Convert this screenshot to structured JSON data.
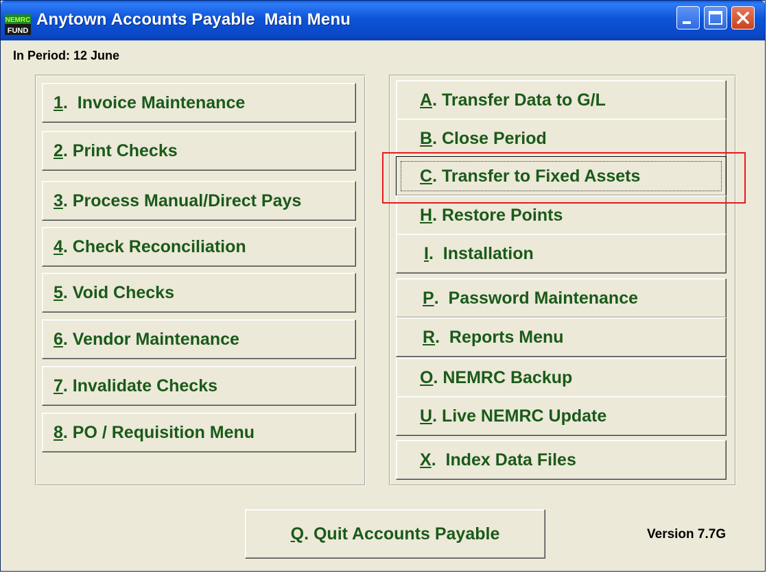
{
  "window": {
    "title": "Anytown Accounts Payable  Main Menu",
    "app_icon_top": "NEMRC",
    "app_icon_bottom": "FUND"
  },
  "period_label": "In Period: 12 June",
  "left_menu": [
    {
      "key": "1",
      "rest": ".  Invoice Maintenance"
    },
    {
      "key": "2",
      "rest": ". Print Checks"
    },
    {
      "key": "3",
      "rest": ". Process Manual/Direct Pays"
    },
    {
      "key": "4",
      "rest": ". Check Reconciliation"
    },
    {
      "key": "5",
      "rest": ". Void Checks"
    },
    {
      "key": "6",
      "rest": ". Vendor Maintenance"
    },
    {
      "key": "7",
      "rest": ". Invalidate Checks"
    },
    {
      "key": "8",
      "rest": ". PO / Requisition Menu"
    }
  ],
  "right_menu": [
    {
      "key": "A",
      "rest": ". Transfer Data to G/L"
    },
    {
      "key": "B",
      "rest": ". Close Period"
    },
    {
      "key": "C",
      "rest": ". Transfer to Fixed Assets"
    },
    {
      "key": "H",
      "rest": ". Restore Points"
    },
    {
      "key": "I",
      "rest": ".  Installation"
    },
    {
      "key": "P",
      "rest": ".  Password Maintenance"
    },
    {
      "key": "R",
      "rest": ".  Reports Menu"
    },
    {
      "key": "O",
      "rest": ". NEMRC Backup"
    },
    {
      "key": "U",
      "rest": ". Live NEMRC Update"
    },
    {
      "key": "X",
      "rest": ".  Index Data Files"
    }
  ],
  "quit": {
    "key": "Q",
    "rest": ". Quit Accounts Payable"
  },
  "version": "Version 7.7G",
  "colors": {
    "button_text": "#1a5a1a",
    "highlight": "#e8181c",
    "titlebar": "#0a48c8"
  }
}
